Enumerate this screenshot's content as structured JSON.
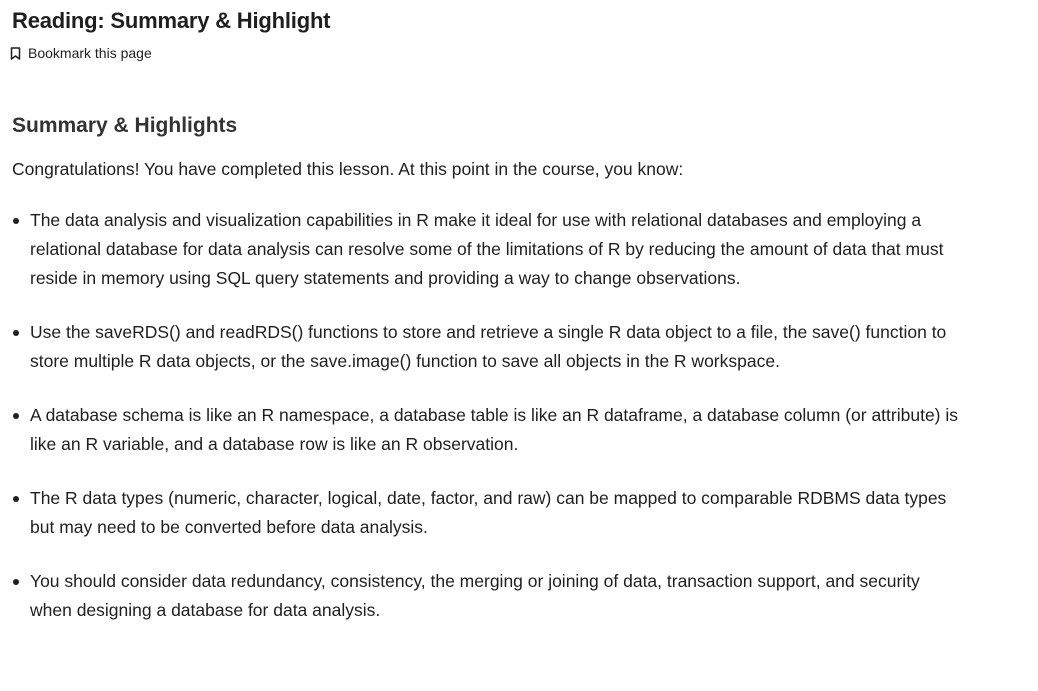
{
  "page": {
    "title": "Reading: Summary & Highlight",
    "bookmark_label": "Bookmark this page"
  },
  "content": {
    "heading": "Summary & Highlights",
    "intro": "Congratulations! You have completed this lesson. At this point in the course, you know:",
    "items": [
      "The data analysis and visualization capabilities in R make it ideal for use with relational databases and employing a relational database for data analysis can resolve some of the limitations of R by reducing the amount of data that must reside in memory using SQL query statements and providing a way to change observations.",
      "Use the saveRDS() and readRDS() functions to store and retrieve a single R data object to a file, the save() function to store multiple R data objects, or the save.image() function to save all objects in the R workspace.",
      "A database schema is like an R namespace, a database table is like an R dataframe, a database column (or attribute) is like an R variable, and a database row is like an R observation.",
      "The R data types (numeric, character, logical, date, factor, and raw) can be mapped to comparable RDBMS data types but may need to be converted before data analysis.",
      "You should consider data redundancy, consistency, the merging or joining of data, transaction support, and security when designing a database for data analysis."
    ]
  },
  "icons": {
    "bookmark": "bookmark-outline-icon"
  },
  "colors": {
    "text": "#1f1f1f",
    "heading": "#333333",
    "background": "#ffffff"
  }
}
